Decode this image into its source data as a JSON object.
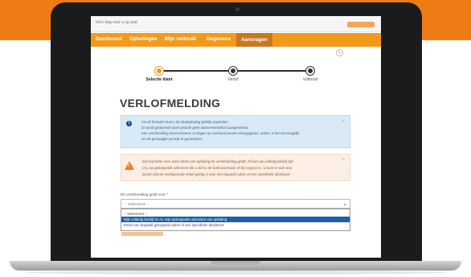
{
  "topbar": {
    "text": "Intro dag voor u op pad"
  },
  "nav": {
    "items": [
      {
        "label": "Dashboard"
      },
      {
        "label": "Ophalingen"
      },
      {
        "label": "Mijn verbruik"
      },
      {
        "label": "Gegevens"
      },
      {
        "label": "Aanvragen"
      }
    ],
    "active_index": 4
  },
  "steps": [
    {
      "label": "Selectie klant"
    },
    {
      "label": "Verlof"
    },
    {
      "label": "Voltooid"
    }
  ],
  "page": {
    "title": "VERLOFMELDING"
  },
  "info": {
    "lines": [
      "Via dit formulier kunt u de afvalophaling tijdelijk stopzetten.",
      "Er wordt gedurende deze periode geen abonnementskost aangerekend.",
      "Een verlofmelding moet minstens 14 dagen op voorhand worden doorgegeven; anders is het niet mogelijk",
      "om de gevraagde periode te garanderen."
    ],
    "close": "×"
  },
  "warning": {
    "line1": "Ibiz harander voor werk adres van ophaling de verlofmelding geldt. Zit kan uw volledig bedrijf zijn",
    "line2_a": "(A), uw gekoppelde adressen die u ziet in de balk bovenaan of bij ",
    "line2_link": "Gegevens",
    "line2_b": ". U kunt er ook voor",
    "line3": "kiezen dat de verlofperiode enkel geldig is voor één bepaald adres of een specifieke afvalsoort.",
    "close": "×"
  },
  "form": {
    "label": "De verlofmelding geldt voor *",
    "select_value": "-- Selecteren --",
    "chevron": "⌄",
    "options": [
      {
        "label": "-- Selecteren --",
        "selected": false
      },
      {
        "label": "Mijn volledig bedrijf en AL mijn gekoppelde adressen van ophaling",
        "selected": true
      },
      {
        "label": "Enkel een bepaald gekoppeld adres of een specifieke afvalsoort",
        "selected": false
      }
    ]
  },
  "colors": {
    "brand_orange": "#ee7b14",
    "nav_orange": "#f29a1a",
    "info_bg": "#d9eaf6",
    "warning_bg": "#fbeee4",
    "selected_option": "#1e5fa8"
  },
  "icons": {
    "info": "info-circle-icon",
    "warning": "warning-triangle-icon",
    "edit": "pencil-icon"
  }
}
